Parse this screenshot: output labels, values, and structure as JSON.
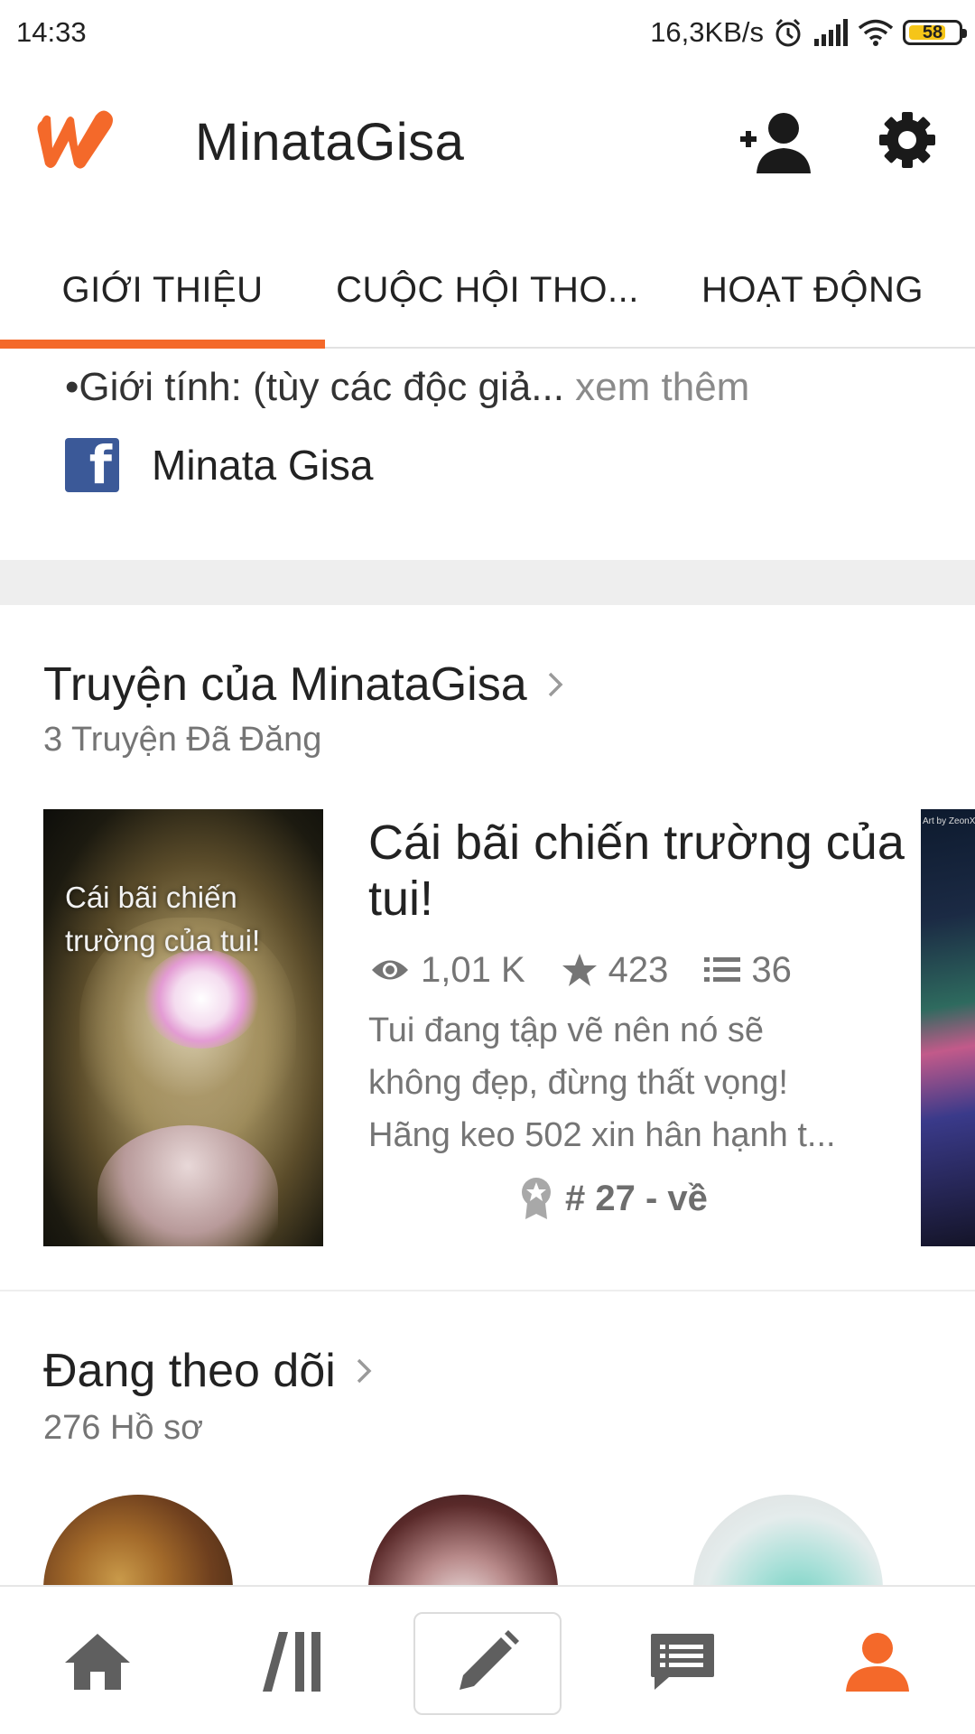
{
  "status_bar": {
    "time": "14:33",
    "network_speed": "16,3KB/s",
    "battery": "58"
  },
  "header": {
    "title": "MinataGisa",
    "brand_color": "#f4692a"
  },
  "tabs": [
    {
      "label": "GIỚI THIỆU",
      "active": true
    },
    {
      "label": "CUỘC HỘI THO...",
      "active": false
    },
    {
      "label": "HOẠT ĐỘNG",
      "active": false
    }
  ],
  "about": {
    "line": "•Giới tính: (tùy các độc giả...",
    "see_more": " xem thêm",
    "facebook_name": "Minata Gisa"
  },
  "stories": {
    "title": "Truyện của MinataGisa",
    "subtitle": "3 Truyện Đã Đăng",
    "items": [
      {
        "cover_text": "Cái bãi chiến trường của tui!",
        "title": "Cái bãi chiến trường của tui!",
        "reads": "1,01 K",
        "votes": "423",
        "parts": "36",
        "description_lines": [
          "Tui đang tập vẽ nên nó sẽ",
          "không đẹp, đừng thất vọng!",
          "Hãng keo 502 xin hân hạnh t..."
        ],
        "rank": "# 27 - về"
      }
    ],
    "next_cover_text": "Art by ZeonXeri"
  },
  "following": {
    "title": "Đang theo dõi",
    "subtitle": "276 Hồ sơ"
  },
  "bottom_nav": {
    "items": [
      "home-icon",
      "library-icon",
      "write-icon",
      "messages-icon",
      "profile-icon"
    ],
    "active": "profile-icon"
  }
}
